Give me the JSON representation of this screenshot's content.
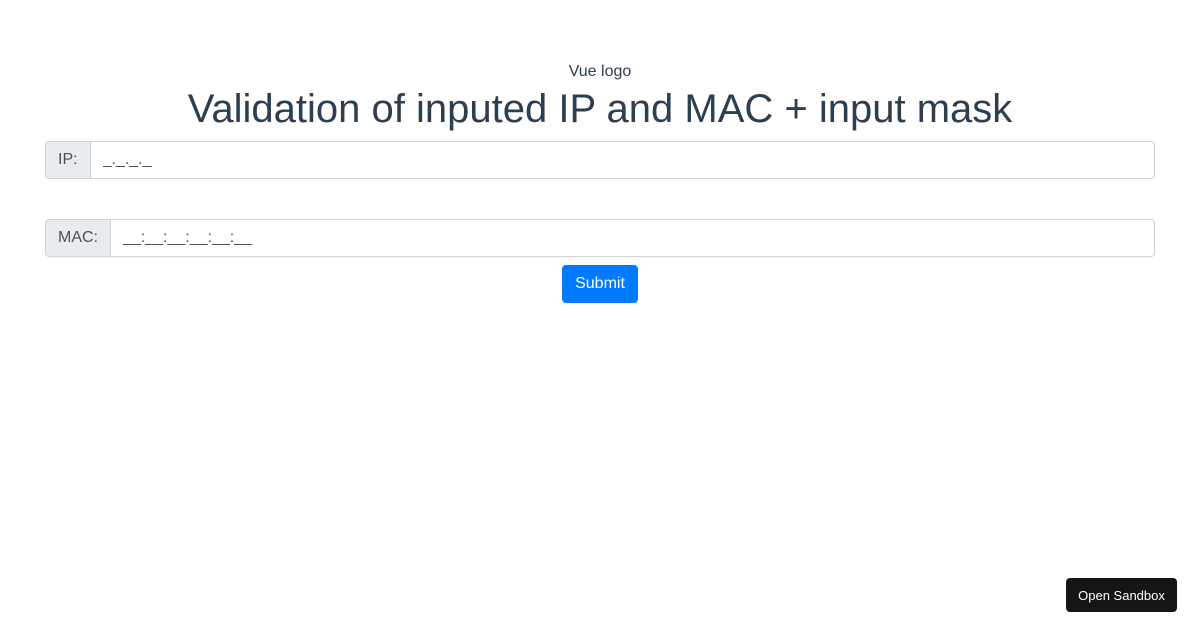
{
  "logo": {
    "alt_text": "Vue logo"
  },
  "header": {
    "title": "Validation of inputed IP and MAC + input mask"
  },
  "form": {
    "ip": {
      "label": "IP:",
      "value": "_._._._"
    },
    "mac": {
      "label": "MAC:",
      "value": "__:__:__:__:__:__"
    },
    "submit_label": "Submit"
  },
  "sandbox": {
    "button_label": "Open Sandbox"
  },
  "colors": {
    "primary": "#007bff",
    "title_text": "#2c3e50",
    "addon_bg": "#e9ecef",
    "border": "#ced4da",
    "sandbox_bg": "#151515"
  }
}
